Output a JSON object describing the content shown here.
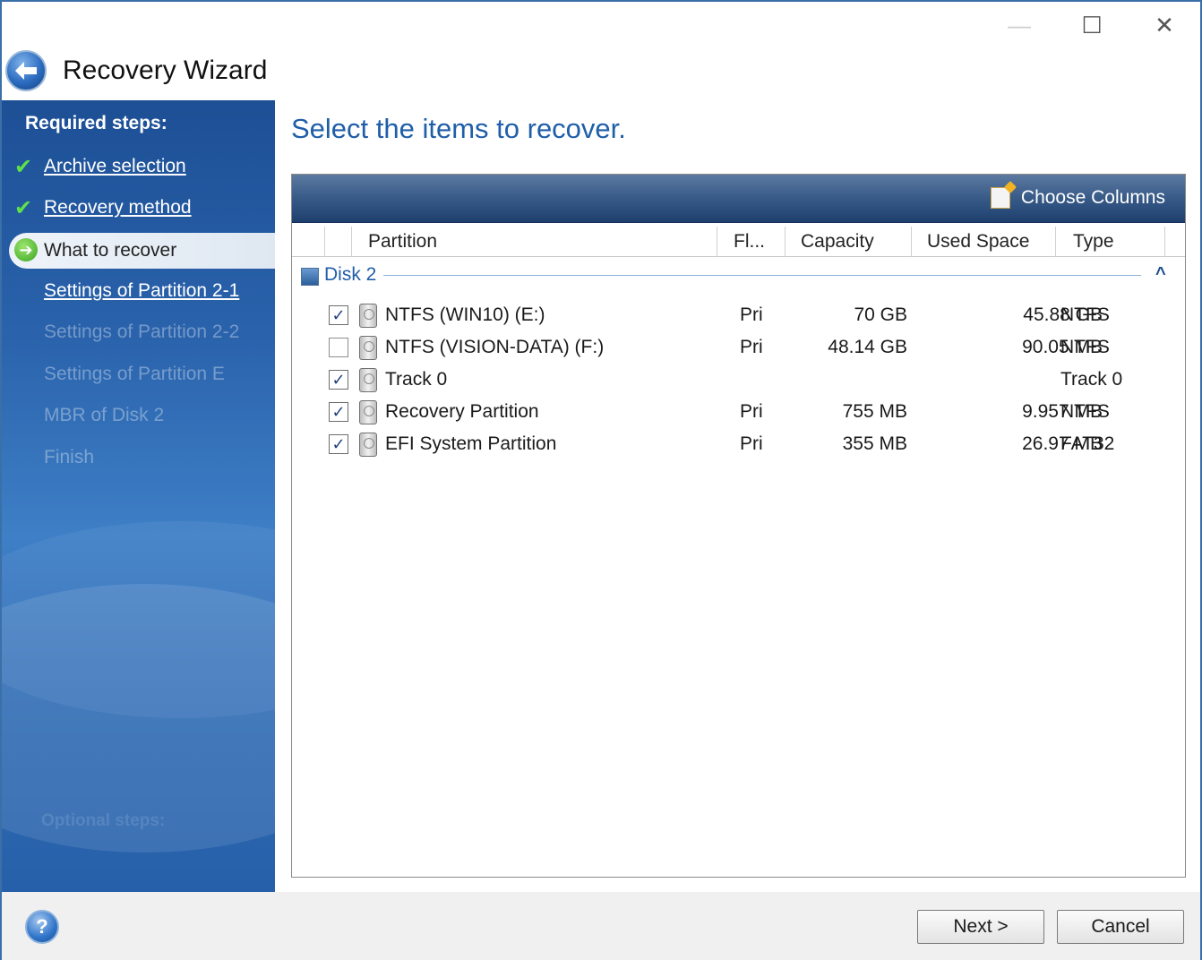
{
  "window": {
    "title": "Recovery Wizard",
    "controls": {
      "minimize": "—",
      "maximize": "☐",
      "close": "✕"
    }
  },
  "sidebar": {
    "heading": "Required steps:",
    "steps": [
      {
        "label": "Archive selection",
        "state": "done"
      },
      {
        "label": "Recovery method",
        "state": "done"
      },
      {
        "label": "What to recover",
        "state": "current"
      },
      {
        "label": "Settings of Partition 2-1",
        "state": "link"
      },
      {
        "label": "Settings of Partition 2-2",
        "state": "disabled"
      },
      {
        "label": "Settings of Partition E",
        "state": "disabled"
      },
      {
        "label": "MBR of Disk 2",
        "state": "disabled"
      },
      {
        "label": "Finish",
        "state": "disabled"
      }
    ],
    "optional_heading": "Optional steps:"
  },
  "main": {
    "heading": "Select the items to recover.",
    "toolbar": {
      "choose_columns": "Choose Columns"
    },
    "columns": [
      "Partition",
      "Fl...",
      "Capacity",
      "Used Space",
      "Type"
    ],
    "disk": {
      "label": "Disk 2",
      "collapse_glyph": "^"
    },
    "rows": [
      {
        "checked": true,
        "name": "NTFS (WIN10) (E:)",
        "flags": "Pri",
        "capacity": "70 GB",
        "used": "45.88 GB",
        "type": "NTFS"
      },
      {
        "checked": false,
        "name": "NTFS (VISION-DATA) (F:)",
        "flags": "Pri",
        "capacity": "48.14 GB",
        "used": "90.05 MB",
        "type": "NTFS"
      },
      {
        "checked": true,
        "name": "Track 0",
        "flags": "",
        "capacity": "",
        "used": "",
        "type": "Track 0"
      },
      {
        "checked": true,
        "name": "Recovery Partition",
        "flags": "Pri",
        "capacity": "755 MB",
        "used": "9.957 MB",
        "type": "NTFS"
      },
      {
        "checked": true,
        "name": "EFI System Partition",
        "flags": "Pri",
        "capacity": "355 MB",
        "used": "26.97 MB",
        "type": "FAT32"
      }
    ]
  },
  "footer": {
    "help": "?",
    "next": "Next >",
    "cancel": "Cancel"
  },
  "icons": {
    "back": "back-arrow-icon",
    "check": "green-check-icon",
    "current": "green-arrow-icon"
  }
}
